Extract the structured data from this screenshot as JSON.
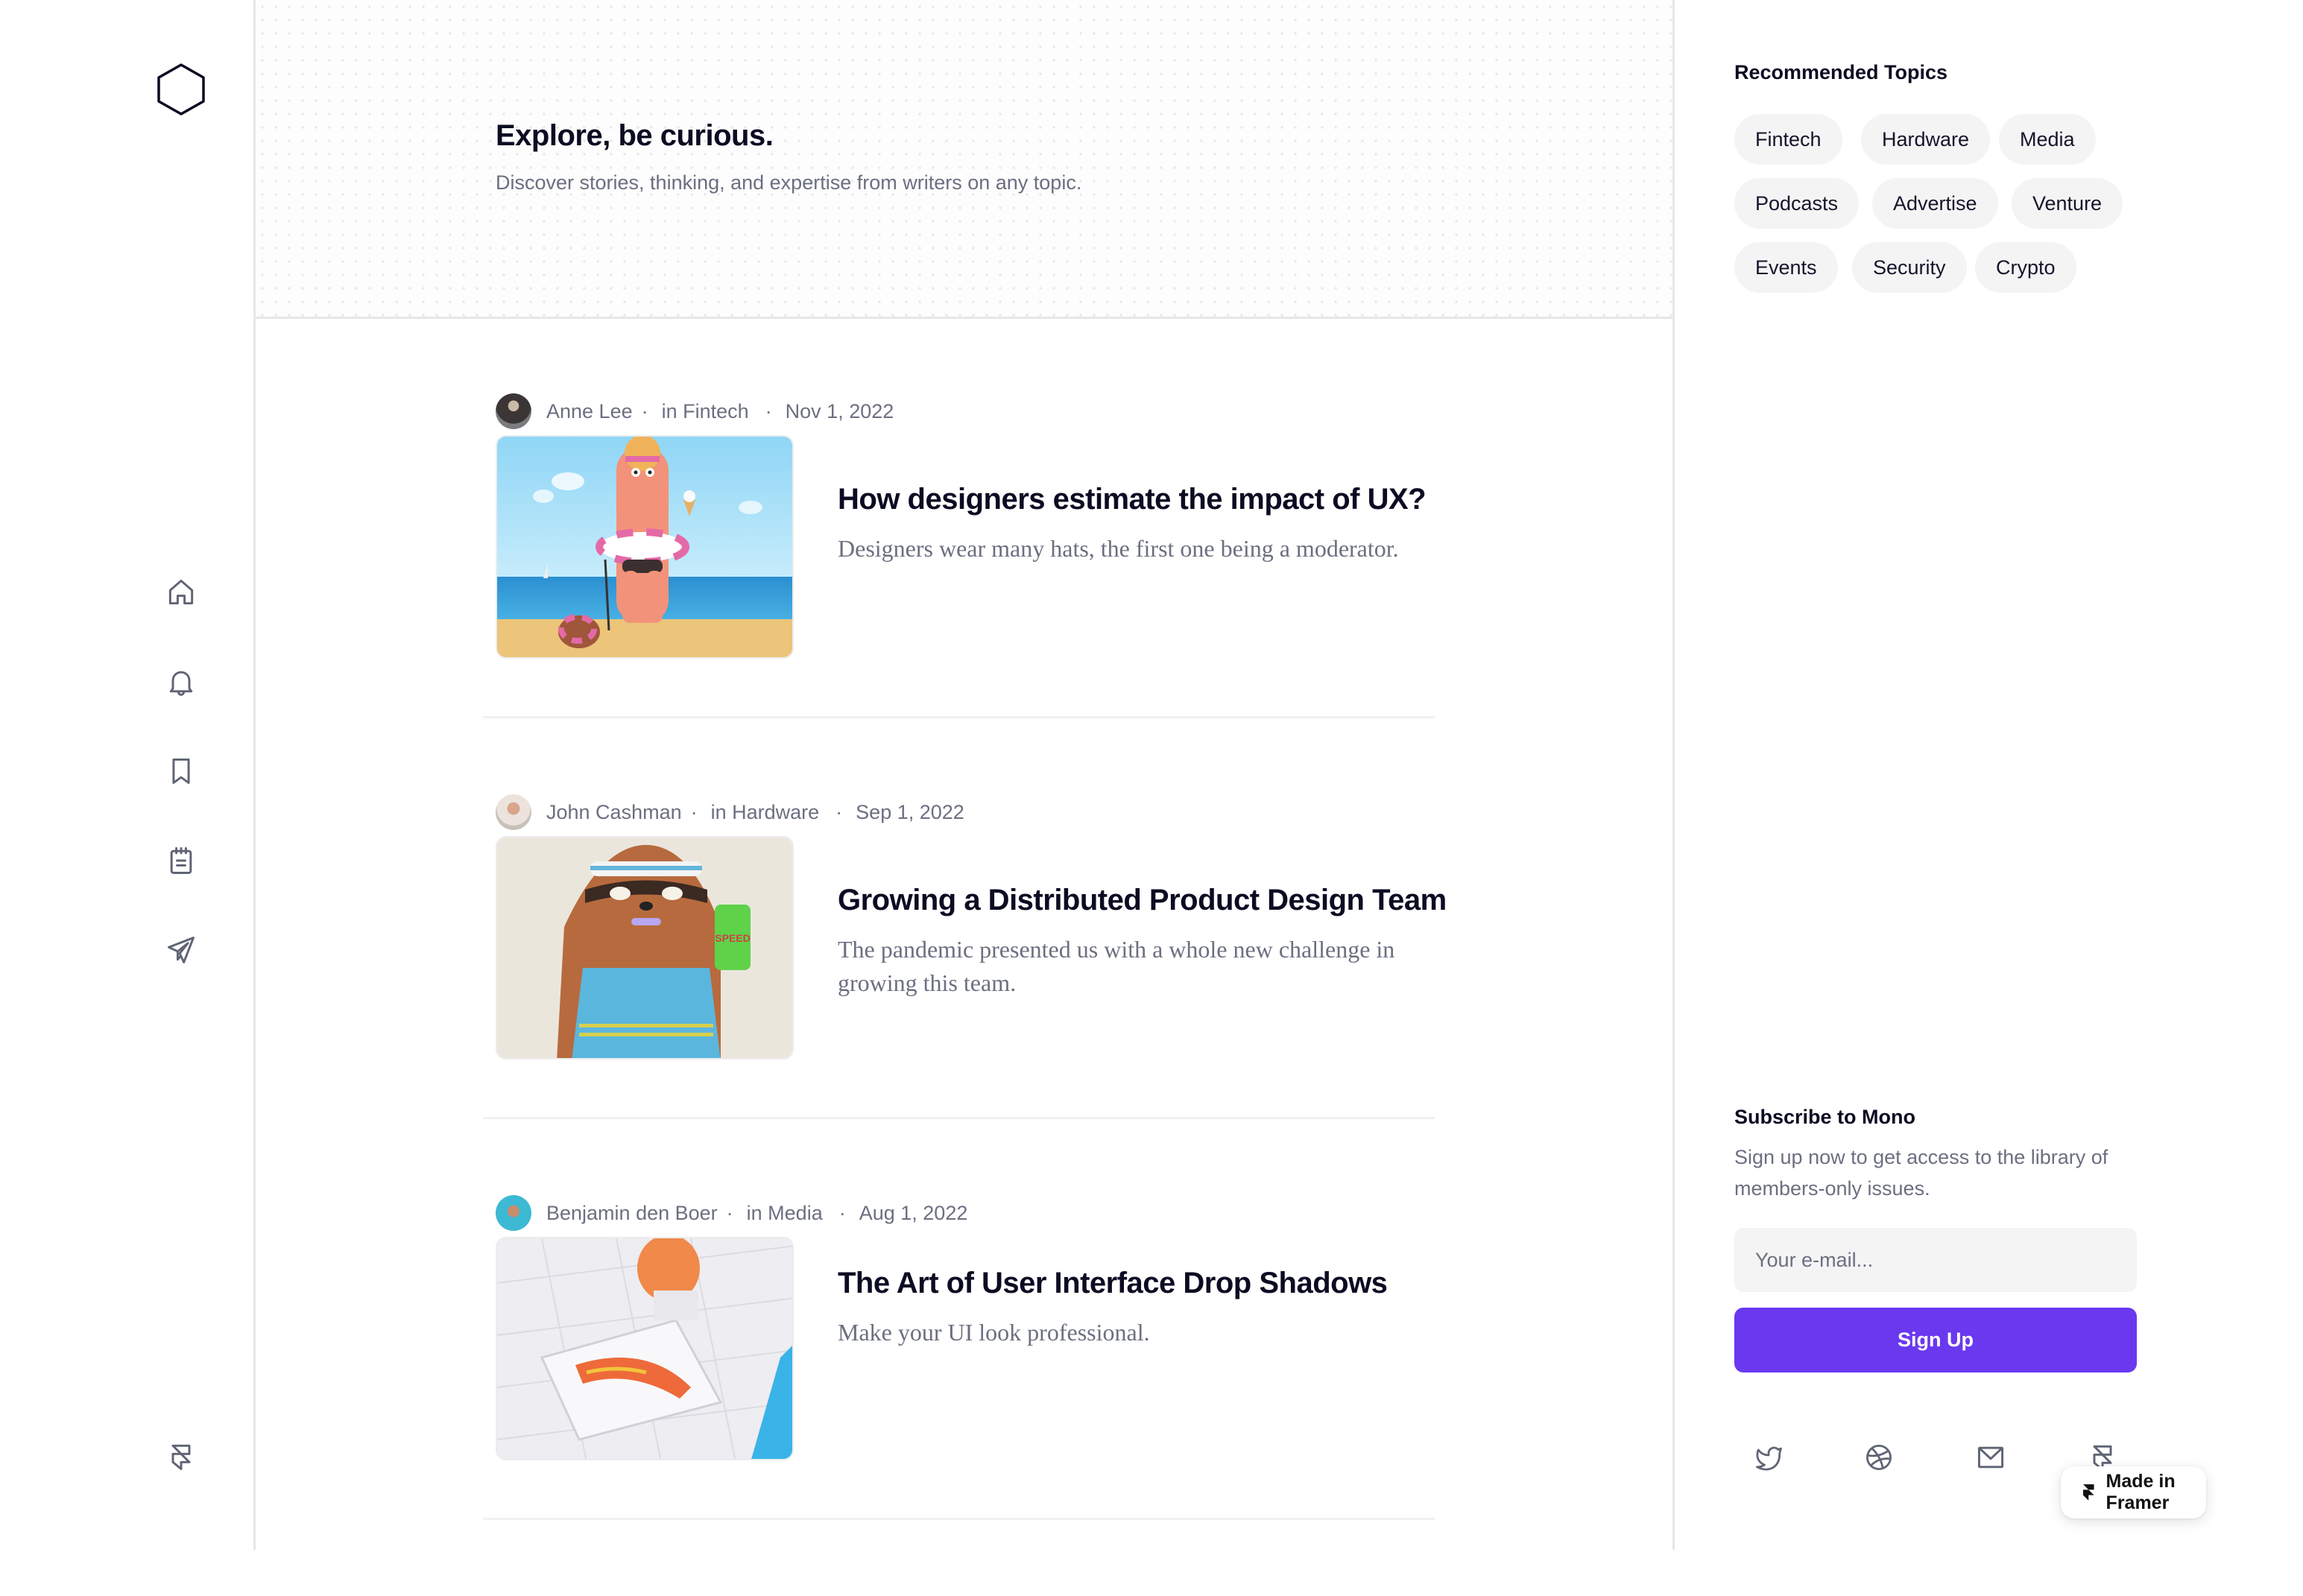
{
  "sidebar": {
    "logo": "hexagon-logo",
    "nav": [
      {
        "name": "home",
        "icon": "home-icon"
      },
      {
        "name": "notifications",
        "icon": "bell-icon"
      },
      {
        "name": "bookmarks",
        "icon": "bookmark-icon"
      },
      {
        "name": "notes",
        "icon": "notepad-icon"
      },
      {
        "name": "send",
        "icon": "paper-plane-icon"
      }
    ],
    "footer_icon": "framer-icon"
  },
  "header": {
    "title": "Explore, be curious.",
    "subtitle": "Discover stories, thinking, and expertise from writers on any topic."
  },
  "articles": [
    {
      "author": "Anne Lee",
      "topic": "in Fintech",
      "date": "Nov 1, 2022",
      "title": "How designers estimate the impact of UX?",
      "description": "Designers wear many hats, the first one being a moderator.",
      "image": "beach character with swim ring and dog"
    },
    {
      "author": "John Cashman",
      "topic": "in Hardware",
      "date": "Sep 1, 2022",
      "title": "Growing a Distributed Product Design Team",
      "description": "The pandemic presented us with a whole new challenge in growing this team.",
      "image": "sloth with headband holding energy drink"
    },
    {
      "author": "Benjamin den Boer",
      "topic": "in Media",
      "date": "Aug 1, 2022",
      "title": "The Art of User Interface Drop Shadows",
      "description": "Make your UI look professional.",
      "image": "hot dog character on sun lounger by pool"
    }
  ],
  "meta_separator": "·",
  "right": {
    "recommended_title": "Recommended Topics",
    "topics": [
      "Fintech",
      "Hardware",
      "Media",
      "Podcasts",
      "Advertise",
      "Venture",
      "Events",
      "Security",
      "Crypto"
    ],
    "subscribe_title": "Subscribe to Mono",
    "subscribe_desc": "Sign up now to get access to the library of members-only issues.",
    "email_placeholder": "Your e-mail...",
    "email_value": "",
    "signup_label": "Sign Up",
    "social": [
      "twitter-icon",
      "dribbble-icon",
      "mail-icon",
      "framer-icon"
    ],
    "badge_label": "Made in Framer"
  },
  "colors": {
    "accent": "#6a38ef",
    "text_primary": "#0b0b22",
    "text_secondary": "#6b6f80",
    "chip_bg": "#f4f4f5",
    "border": "#e7e7e9"
  }
}
